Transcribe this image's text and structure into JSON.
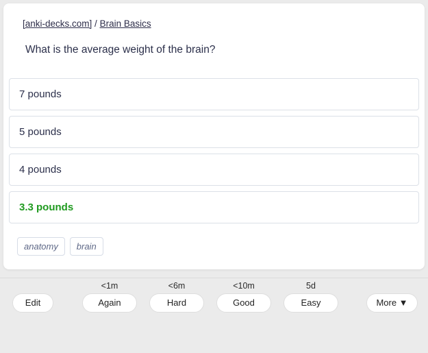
{
  "breadcrumb": {
    "source_label": "[anki-decks.com]",
    "separator": " / ",
    "deck": "Brain Basics"
  },
  "question": "What is the average weight of the brain?",
  "choices": [
    {
      "text": "7 pounds",
      "correct": false
    },
    {
      "text": "5 pounds",
      "correct": false
    },
    {
      "text": "4 pounds",
      "correct": false
    },
    {
      "text": "3.3 pounds",
      "correct": true
    }
  ],
  "tags": [
    "anatomy",
    "brain"
  ],
  "toolbar": {
    "edit": "Edit",
    "more": "More ▼",
    "ratings": [
      {
        "key": "again",
        "label": "Again",
        "interval": "<1m"
      },
      {
        "key": "hard",
        "label": "Hard",
        "interval": "<6m"
      },
      {
        "key": "good",
        "label": "Good",
        "interval": "<10m"
      },
      {
        "key": "easy",
        "label": "Easy",
        "interval": "5d"
      }
    ]
  }
}
